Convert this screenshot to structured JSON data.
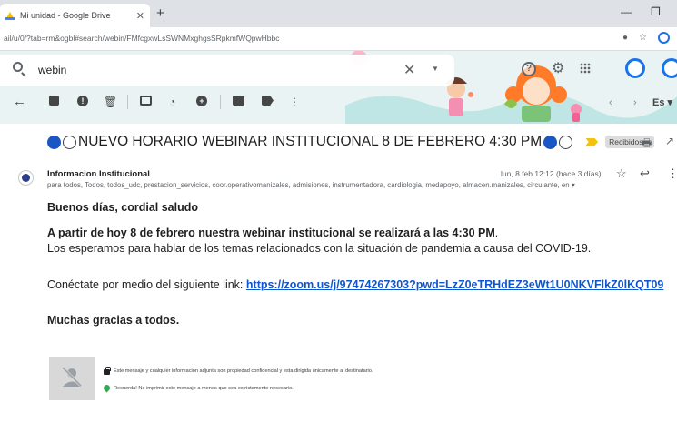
{
  "browser": {
    "tab_title": "Mi unidad - Google Drive",
    "tab_close": "✕",
    "new_tab": "+",
    "minimize": "—",
    "restore": "❐",
    "url": "ail/u/0/?tab=rm&ogbl#search/webin/FMfcgxwLsSWNMxghgsSRpkmfWQpwHbbc"
  },
  "search": {
    "value": "webin",
    "clear": "✕",
    "options": "▼"
  },
  "header": {
    "help": "?",
    "settings": "⚙"
  },
  "toolbar": {
    "back": "←",
    "report": "!",
    "delete": "🗑",
    "snooze": "◔",
    "more": "⋮",
    "prev": "‹",
    "next": "›",
    "language": "Es ▾"
  },
  "email": {
    "subject": "NUEVO HORARIO WEBINAR INSTITUCIONAL 8 DE FEBRERO 4:30 PM",
    "label": "Recibidos",
    "label_close": "×",
    "sender": "Informacion Institucional",
    "recipients": "para todos, Todos, todos_udc, prestacion_servicios, coor.operativomanizales, admisiones, instrumentadora, cardiologia, medapoyo, almacen.manizales, circulante, en ▾",
    "date": "lun, 8 feb 12:12 (hace 3 días)",
    "star": "☆",
    "reply": "↩",
    "more": "⋮",
    "greeting": "Buenos días, cordial saludo",
    "line1_bold": "A partir de hoy 8 de febrero nuestra webinar institucional se realizará a las 4:30 PM",
    "line1_tail": ".",
    "line2": "Los esperamos para hablar de los temas relacionados con la situación de pandemia a causa del COVID-19.",
    "link_prefix": "Conéctate por medio del siguiente link: ",
    "link": "https://zoom.us/j/97474267303?pwd=LzZ0eTRHdEZ3eWt1U0NKVFlkZ0lKQT09",
    "thanks": "Muchas gracias a todos."
  },
  "signature": {
    "confidential": "Este mensaje y cualquier información adjunta son propiedad confidencial y esta dirigida únicamente al destinatario.",
    "eco": "Recuerda! No imprimir este mensaje a menos que sea estrictamente necesario."
  },
  "colors": {
    "accent": "#1a73e8",
    "link": "#1155cc",
    "important": "#f4c20d"
  }
}
